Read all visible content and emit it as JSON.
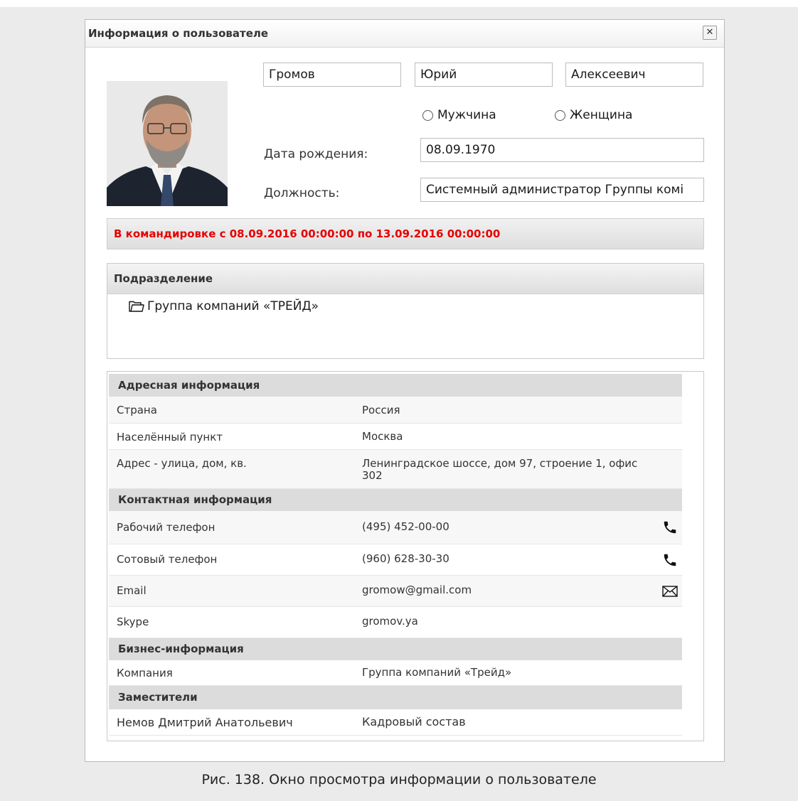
{
  "window": {
    "title": "Информация о пользователе",
    "close_label": "✕"
  },
  "user": {
    "last_name": "Громов",
    "first_name": "Юрий",
    "middle_name": "Алексеевич",
    "gender_options": [
      "Мужчина",
      "Женщина"
    ],
    "birthdate_label": "Дата рождения:",
    "birthdate": "08.09.1970",
    "position_label": "Должность:",
    "position": "Системный администратор Группы комі"
  },
  "status": {
    "text": "В командировке с 08.09.2016 00:00:00 по 13.09.2016 00:00:00",
    "color": "#e60000"
  },
  "department": {
    "title": "Подразделение",
    "item": "Группа компаний «ТРЕЙД»"
  },
  "sections": {
    "address": {
      "title": "Адресная информация",
      "rows": [
        {
          "key": "Страна",
          "value": "Россия"
        },
        {
          "key": "Населённый пункт",
          "value": "Москва"
        },
        {
          "key": "Адрес - улица, дом, кв.",
          "value": "Ленинградское шоссе, дом 97, строение 1, офис 302"
        }
      ]
    },
    "contact": {
      "title": "Контактная информация",
      "rows": [
        {
          "key": "Рабочий телефон",
          "value": "(495) 452-00-00",
          "icon": "phone-icon"
        },
        {
          "key": "Сотовый телефон",
          "value": "(960) 628-30-30",
          "icon": "phone-icon"
        },
        {
          "key": "Email",
          "value": "gromow@gmail.com",
          "icon": "mail-icon"
        },
        {
          "key": "Skype",
          "value": "gromov.ya"
        }
      ]
    },
    "business": {
      "title": "Бизнес-информация",
      "rows": [
        {
          "key": "Компания",
          "value": "Группа компаний «Трейд»"
        }
      ]
    },
    "deputies": {
      "title": "Заместители",
      "rows": [
        {
          "key": "Немов Дмитрий Анатольевич",
          "value": "Кадровый состав"
        }
      ]
    }
  },
  "caption": "Рис. 138. Окно просмотра информации о пользователе"
}
